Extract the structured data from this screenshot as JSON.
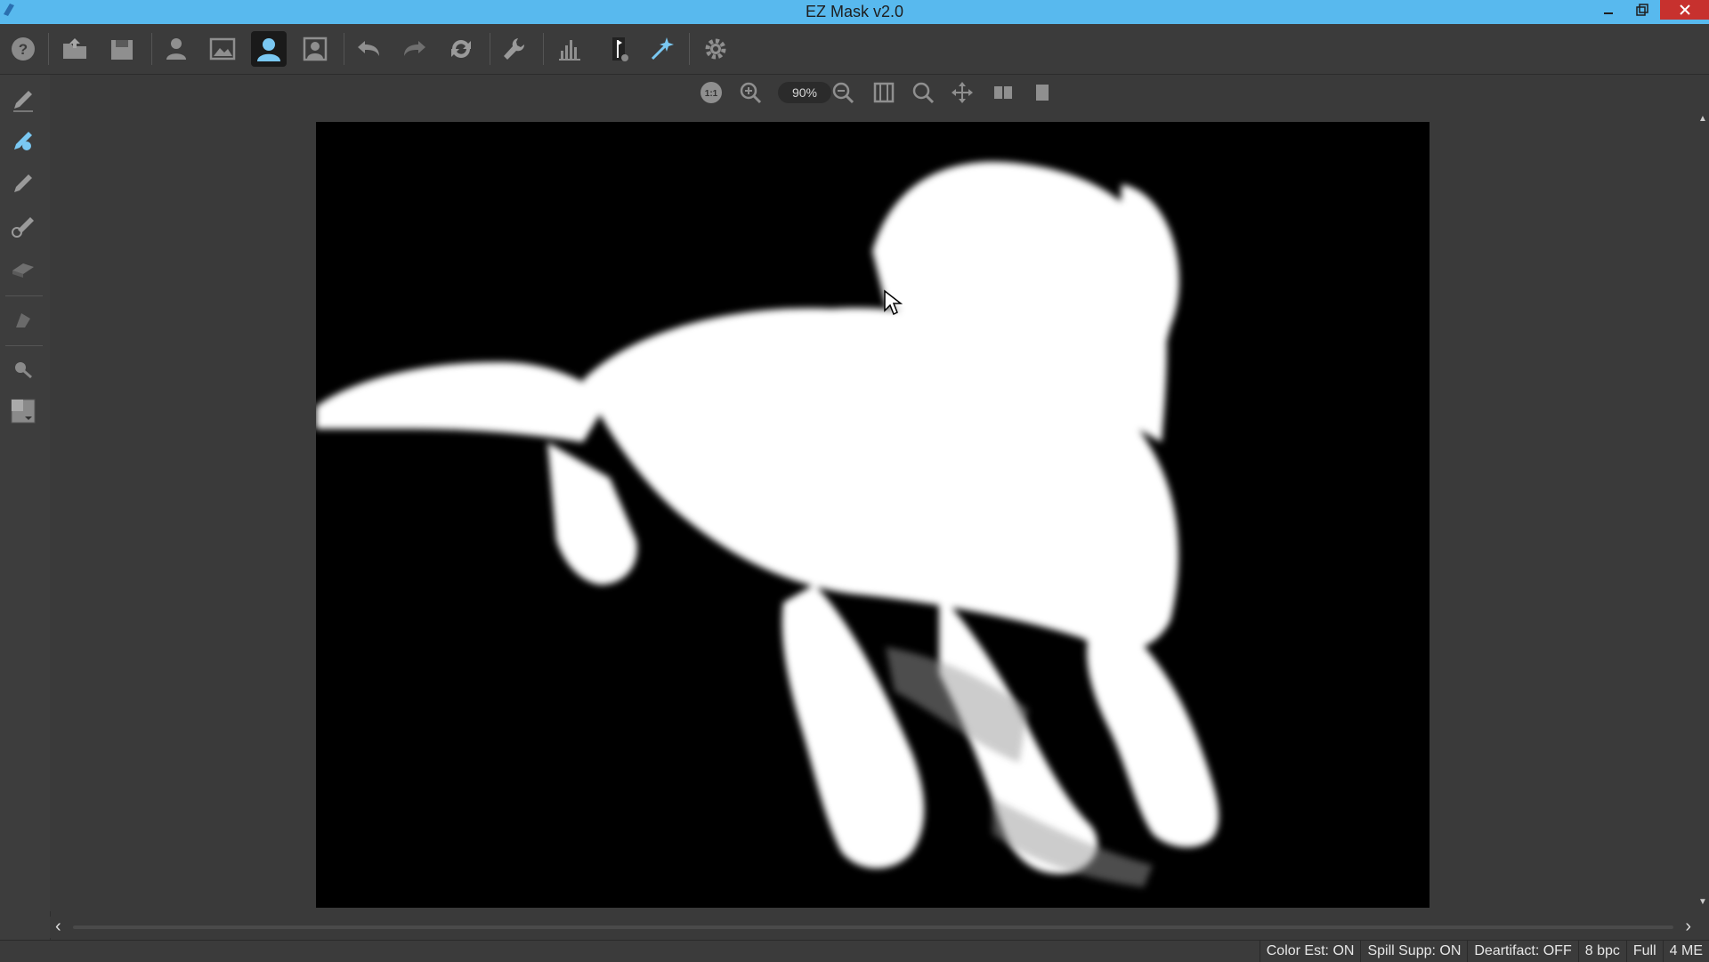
{
  "window": {
    "title": "EZ Mask v2.0"
  },
  "toolbar": {
    "buttons": [
      {
        "icon": "help-icon"
      },
      {
        "icon": "open-folder-icon"
      },
      {
        "icon": "save-icon"
      },
      {
        "icon": "person-icon"
      },
      {
        "icon": "image-icon"
      },
      {
        "icon": "mask-view-icon",
        "active": true
      },
      {
        "icon": "composite-view-icon"
      },
      {
        "icon": "undo-icon"
      },
      {
        "icon": "redo-icon"
      },
      {
        "icon": "refresh-icon"
      },
      {
        "icon": "wrench-icon"
      },
      {
        "icon": "histogram-icon"
      },
      {
        "icon": "flag-icon"
      },
      {
        "icon": "magic-wand-icon"
      },
      {
        "icon": "gear-icon"
      }
    ]
  },
  "zoombar": {
    "zoom_value": "90%"
  },
  "statusbar": {
    "items": [
      "Color Est: ON",
      "Spill Supp: ON",
      "Deartifact: OFF",
      "8 bpc",
      "Full",
      "4 ME"
    ]
  },
  "colors": {
    "titlebar": "#58b9ee",
    "close": "#c7312e",
    "accent": "#7ac8f2"
  }
}
